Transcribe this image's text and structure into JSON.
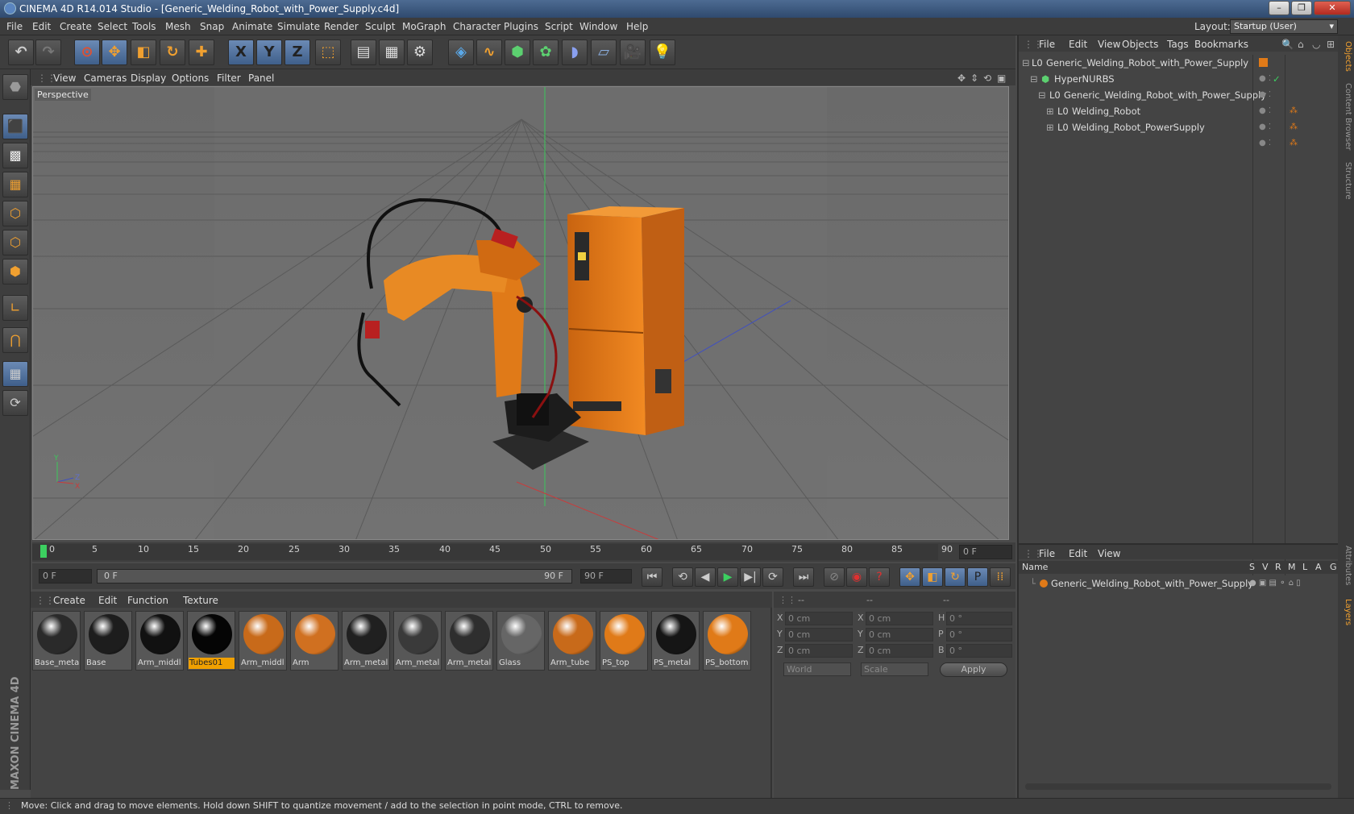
{
  "app": {
    "title": "CINEMA 4D R14.014 Studio - [Generic_Welding_Robot_with_Power_Supply.c4d]",
    "window_buttons": [
      "–",
      "❐",
      "✕"
    ]
  },
  "menubar": {
    "items": [
      "File",
      "Edit",
      "Create",
      "Select",
      "Tools",
      "Mesh",
      "Snap",
      "Animate",
      "Simulate",
      "Render",
      "Sculpt",
      "MoGraph",
      "Character",
      "Plugins",
      "Script",
      "Window",
      "Help"
    ],
    "layout_label": "Layout:",
    "layout_value": "Startup (User)"
  },
  "toolbar": {
    "icons": [
      "undo-icon",
      "redo-icon",
      "live-selection-icon",
      "move-icon",
      "scale-icon",
      "rotate-icon",
      "add-icon",
      "x-axis-icon",
      "y-axis-icon",
      "z-axis-icon",
      "coord-system-icon",
      "render-view-icon",
      "render-picture-viewer-icon",
      "edit-render-settings-icon",
      "cube-icon",
      "spline-pen-icon",
      "subdivision-icon",
      "array-icon",
      "deformer-icon",
      "floor-icon",
      "camera-icon",
      "light-icon"
    ],
    "axis_labels": [
      "X",
      "Y",
      "Z"
    ]
  },
  "lefttools": {
    "icons": [
      "make-editable-icon",
      "model-mode-icon",
      "texture-mode-icon",
      "workplane-mode-icon",
      "point-mode-icon",
      "edge-mode-icon",
      "polygon-mode-icon",
      "axis-mode-icon",
      "snap-icon",
      "lock-workplane-icon",
      "solo-icon"
    ]
  },
  "viewport": {
    "menu": [
      "View",
      "Cameras",
      "Display",
      "Options",
      "Filter",
      "Panel"
    ],
    "label": "Perspective",
    "axis_labels": {
      "x": "X",
      "y": "Y",
      "z": "Z"
    }
  },
  "timeline": {
    "ticks": [
      "0",
      "5",
      "10",
      "15",
      "20",
      "25",
      "30",
      "35",
      "40",
      "45",
      "50",
      "55",
      "60",
      "65",
      "70",
      "75",
      "80",
      "85",
      "90"
    ],
    "current_frame": "0 F",
    "start_field": "0 F",
    "range_start": "0 F",
    "range_end": "90 F",
    "end_field": "90 F"
  },
  "playback": {
    "buttons": [
      "goto-start-icon",
      "prev-key-icon",
      "prev-frame-icon",
      "play-icon",
      "next-frame-icon",
      "next-key-icon",
      "goto-end-icon"
    ],
    "record_buttons": [
      "autokey-icon",
      "record-icon",
      "help-icon"
    ],
    "key_buttons": [
      "key-position-icon",
      "key-scale-icon",
      "key-rotation-icon",
      "key-param-icon",
      "key-pla-icon"
    ]
  },
  "materials": {
    "menu": [
      "Create",
      "Edit",
      "Function",
      "Texture"
    ],
    "items": [
      {
        "label": "Base_metal",
        "color": "#2a2a2a",
        "selected": false
      },
      {
        "label": "Base",
        "color": "#1d1d1d",
        "selected": false
      },
      {
        "label": "Arm_middl",
        "color": "#111111",
        "selected": false
      },
      {
        "label": "Tubes01",
        "color": "#050505",
        "selected": true
      },
      {
        "label": "Arm_middl",
        "color": "#c86a1a",
        "selected": false
      },
      {
        "label": "Arm",
        "color": "#d07020",
        "selected": false
      },
      {
        "label": "Arm_metal",
        "color": "#202020",
        "selected": false
      },
      {
        "label": "Arm_metal",
        "color": "#3a3a3a",
        "selected": false
      },
      {
        "label": "Arm_metal",
        "color": "#2e2e2e",
        "selected": false
      },
      {
        "label": "Glass",
        "color": "#666666",
        "selected": false
      },
      {
        "label": "Arm_tube",
        "color": "#c86a1a",
        "selected": false
      },
      {
        "label": "PS_top",
        "color": "#e07a18",
        "selected": false
      },
      {
        "label": "PS_metal",
        "color": "#151515",
        "selected": false
      },
      {
        "label": "PS_bottom",
        "color": "#e07a18",
        "selected": false
      }
    ]
  },
  "coordinates": {
    "headers": [
      "--",
      "--",
      "--"
    ],
    "rows": [
      {
        "a": "X",
        "av": "0 cm",
        "b": "X",
        "bv": "0 cm",
        "c": "H",
        "cv": "0 °"
      },
      {
        "a": "Y",
        "av": "0 cm",
        "b": "Y",
        "bv": "0 cm",
        "c": "P",
        "cv": "0 °"
      },
      {
        "a": "Z",
        "av": "0 cm",
        "b": "Z",
        "bv": "0 cm",
        "c": "B",
        "cv": "0 °"
      }
    ],
    "world": "World",
    "scale": "Scale",
    "apply": "Apply"
  },
  "objects": {
    "menu": [
      "File",
      "Edit",
      "View",
      "Objects",
      "Tags",
      "Bookmarks"
    ],
    "tree": [
      {
        "name": "Generic_Welding_Robot_with_Power_Supply",
        "indent": 0
      },
      {
        "name": "HyperNURBS",
        "indent": 1
      },
      {
        "name": "Generic_Welding_Robot_with_Power_Supply",
        "indent": 2
      },
      {
        "name": "Welding_Robot",
        "indent": 3
      },
      {
        "name": "Welding_Robot_PowerSupply",
        "indent": 3
      }
    ]
  },
  "layers": {
    "menu": [
      "File",
      "Edit",
      "View"
    ],
    "columns": [
      "Name",
      "S",
      "V",
      "R",
      "M",
      "L",
      "A",
      "G"
    ],
    "rows": [
      {
        "name": "Generic_Welding_Robot_with_Power_Supply",
        "color": "#e07a18"
      }
    ]
  },
  "side_tabs": [
    "Objects",
    "Content Browser",
    "Structure",
    "Attributes",
    "Layers"
  ],
  "status": "Move: Click and drag to move elements. Hold down SHIFT to quantize movement / add to the selection in point mode, CTRL to remove.",
  "brand": {
    "logo": "MAXON CINEMA 4D"
  },
  "colors": {
    "accent": "#f0a000",
    "robot": "#e07a18",
    "selection": "#5a7aa8"
  }
}
